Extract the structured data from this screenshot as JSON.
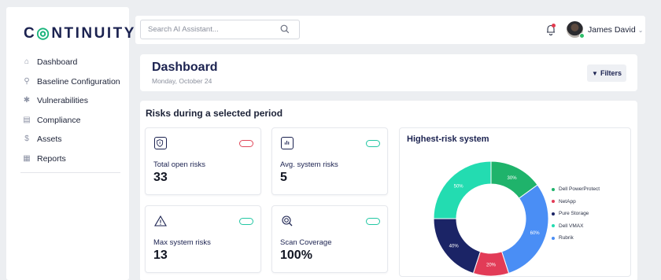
{
  "brand": {
    "logo_text": "CONTINUITY"
  },
  "sidebar": {
    "items": [
      {
        "label": "Dashboard",
        "icon": "home-icon"
      },
      {
        "label": "Baseline Configuration",
        "icon": "baseline-icon"
      },
      {
        "label": "Vulnerabilities",
        "icon": "bug-icon"
      },
      {
        "label": "Compliance",
        "icon": "clipboard-icon"
      },
      {
        "label": "Assets",
        "icon": "dollar-icon"
      },
      {
        "label": "Reports",
        "icon": "report-icon"
      }
    ]
  },
  "topbar": {
    "search_placeholder": "Search AI Assistant...",
    "user_name": "James David"
  },
  "header": {
    "title": "Dashboard",
    "date": "Monday, October 24",
    "filters_label": "Filters"
  },
  "main": {
    "section_title": "Risks during a selected period",
    "stats": [
      {
        "label": "Total open risks",
        "value": "33",
        "icon": "shield-icon",
        "trend_color": "#e0485a"
      },
      {
        "label": "Avg. system risks",
        "value": "5",
        "icon": "bar-chart-icon",
        "trend_color": "#22c7a3"
      },
      {
        "label": "Max system risks",
        "value": "13",
        "icon": "warning-icon",
        "trend_color": "#22c7a3"
      },
      {
        "label": "Scan Coverage",
        "value": "100%",
        "icon": "scan-icon",
        "trend_color": "#22c7a3"
      }
    ]
  },
  "chart_data": {
    "type": "pie",
    "title": "Highest-risk system",
    "series": [
      {
        "name": "Dell PowerProtect",
        "value": 30,
        "label": "30%",
        "color": "#1fb36b"
      },
      {
        "name": "NetApp",
        "value": 60,
        "label": "60%",
        "color": "#e23b57"
      },
      {
        "name": "Pure Storage",
        "value": 20,
        "label": "20%",
        "color": "#1b2466"
      },
      {
        "name": "Dell VMAX",
        "value": 40,
        "label": "40%",
        "color": "#23dcb1"
      },
      {
        "name": "Rubrik",
        "value": 50,
        "label": "50%",
        "color": "#4a8ef5"
      }
    ],
    "slices_in_clockwise_order_from_top": [
      {
        "name": "Dell PowerProtect",
        "label": "30%",
        "value": 30
      },
      {
        "name": "Rubrik",
        "label": "60%",
        "value": 60
      },
      {
        "name": "NetApp",
        "label": "20%",
        "value": 20
      },
      {
        "name": "Pure Storage",
        "label": "40%",
        "value": 40
      },
      {
        "name": "Dell VMAX",
        "label": "50%",
        "value": 50
      }
    ],
    "legend_position": "right"
  }
}
